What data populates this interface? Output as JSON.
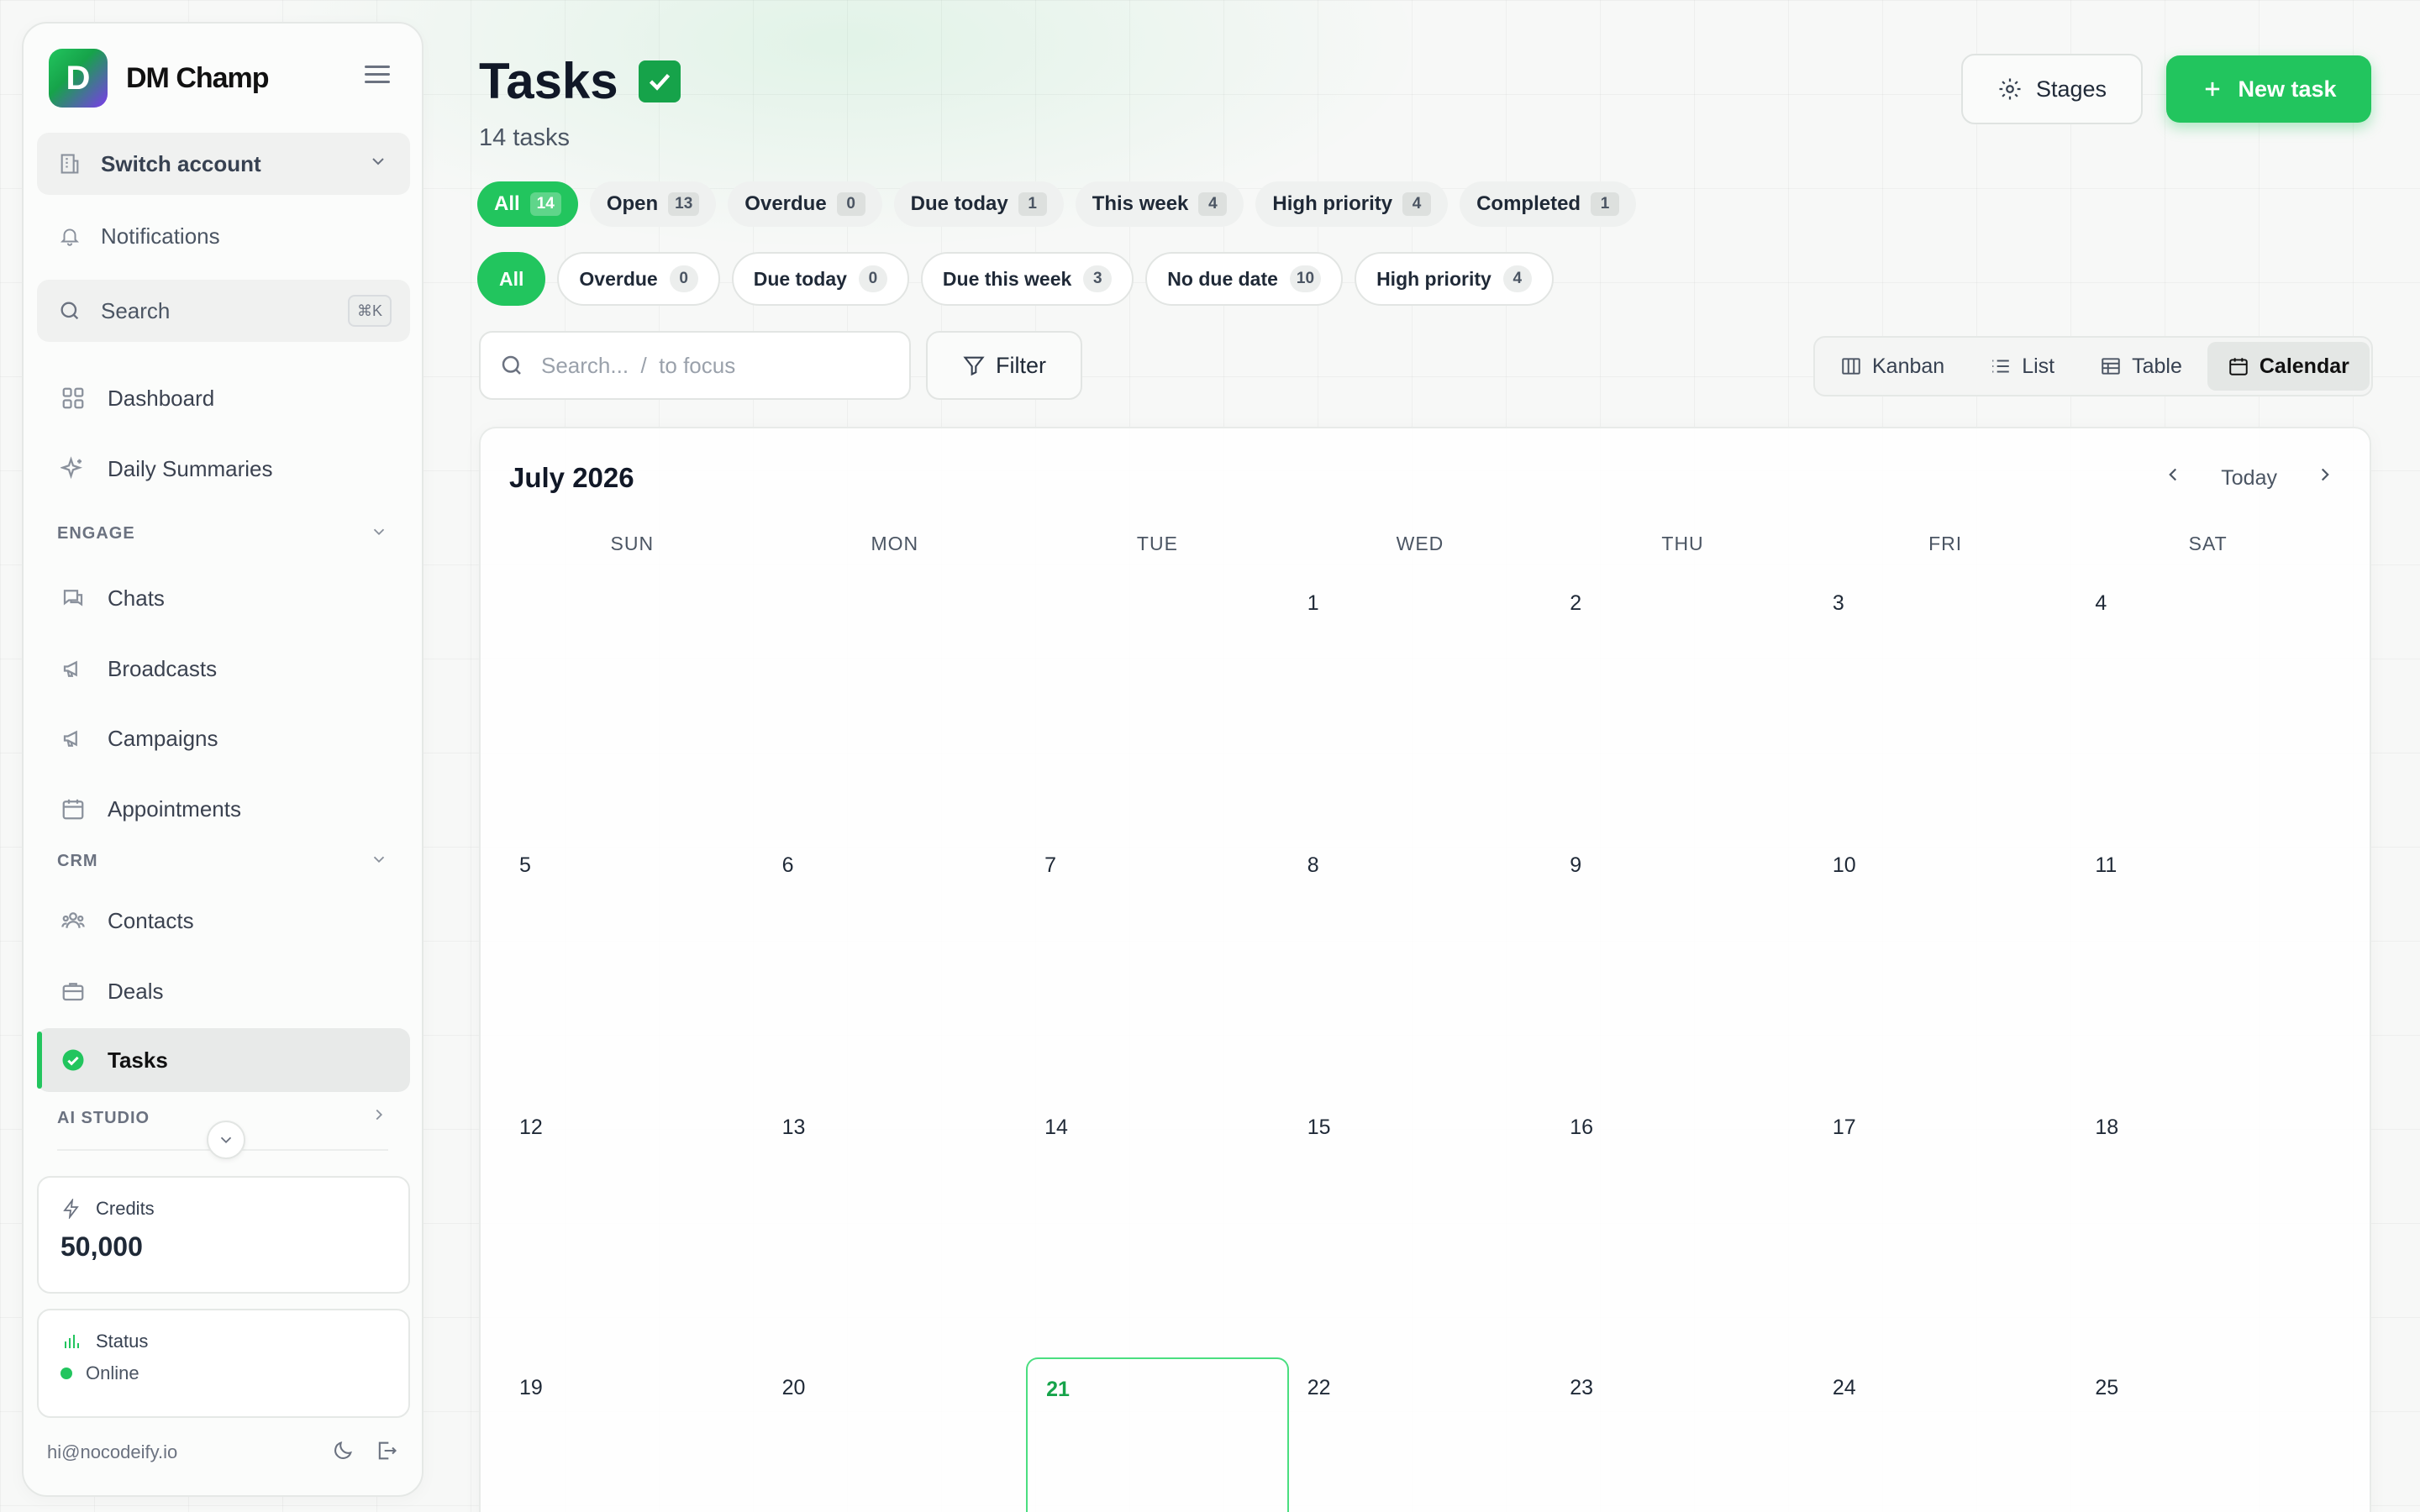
{
  "app": {
    "brand_name": "DM Champ",
    "logo_letter": "D",
    "accent_color": "#22c55e"
  },
  "sidebar": {
    "switch_account": "Switch account",
    "notifications": "Notifications",
    "search_label": "Search",
    "search_shortcut": "⌘K",
    "nav_top": [
      {
        "label": "Dashboard",
        "icon": "grid-icon"
      },
      {
        "label": "Daily Summaries",
        "icon": "sparkles-icon"
      }
    ],
    "sections": {
      "engage": "ENGAGE",
      "crm": "CRM",
      "ai_studio": "AI STUDIO"
    },
    "engage_items": [
      {
        "label": "Chats",
        "icon": "chat-icon"
      },
      {
        "label": "Broadcasts",
        "icon": "megaphone-icon"
      },
      {
        "label": "Campaigns",
        "icon": "megaphone-icon"
      },
      {
        "label": "Appointments",
        "icon": "calendar-icon"
      }
    ],
    "crm_items": [
      {
        "label": "Contacts",
        "icon": "users-icon"
      },
      {
        "label": "Deals",
        "icon": "briefcase-icon"
      },
      {
        "label": "Tasks",
        "icon": "check-circle-icon",
        "active": true
      }
    ],
    "credits_label": "Credits",
    "credits_value": "50,000",
    "status_label": "Status",
    "status_value": "Online",
    "email": "hi@nocodeify.io"
  },
  "header": {
    "title": "Tasks",
    "subtitle": "14 tasks",
    "stages_button": "Stages",
    "new_task_button": "New task"
  },
  "status_filters": [
    {
      "label": "All",
      "count": "14",
      "active": true
    },
    {
      "label": "Open",
      "count": "13"
    },
    {
      "label": "Overdue",
      "count": "0"
    },
    {
      "label": "Due today",
      "count": "1"
    },
    {
      "label": "This week",
      "count": "4"
    },
    {
      "label": "High priority",
      "count": "4"
    },
    {
      "label": "Completed",
      "count": "1"
    }
  ],
  "due_filters": [
    {
      "label": "All",
      "count": null,
      "active": true
    },
    {
      "label": "Overdue",
      "count": "0"
    },
    {
      "label": "Due today",
      "count": "0"
    },
    {
      "label": "Due this week",
      "count": "3"
    },
    {
      "label": "No due date",
      "count": "10"
    },
    {
      "label": "High priority",
      "count": "4"
    }
  ],
  "toolbar": {
    "search_placeholder": "Search...  /  to focus",
    "filter_button": "Filter",
    "views": [
      {
        "label": "Kanban",
        "icon": "columns-icon"
      },
      {
        "label": "List",
        "icon": "list-icon"
      },
      {
        "label": "Table",
        "icon": "table-icon"
      },
      {
        "label": "Calendar",
        "icon": "calendar-icon",
        "active": true
      }
    ]
  },
  "calendar": {
    "month_label": "July 2026",
    "today_button": "Today",
    "weekdays": [
      "SUN",
      "MON",
      "TUE",
      "WED",
      "THU",
      "FRI",
      "SAT"
    ],
    "today_date": "21",
    "weeks": [
      [
        "",
        "",
        "",
        "1",
        "2",
        "3",
        "4"
      ],
      [
        "5",
        "6",
        "7",
        "8",
        "9",
        "10",
        "11"
      ],
      [
        "12",
        "13",
        "14",
        "15",
        "16",
        "17",
        "18"
      ],
      [
        "19",
        "20",
        "21",
        "22",
        "23",
        "24",
        "25"
      ]
    ]
  }
}
